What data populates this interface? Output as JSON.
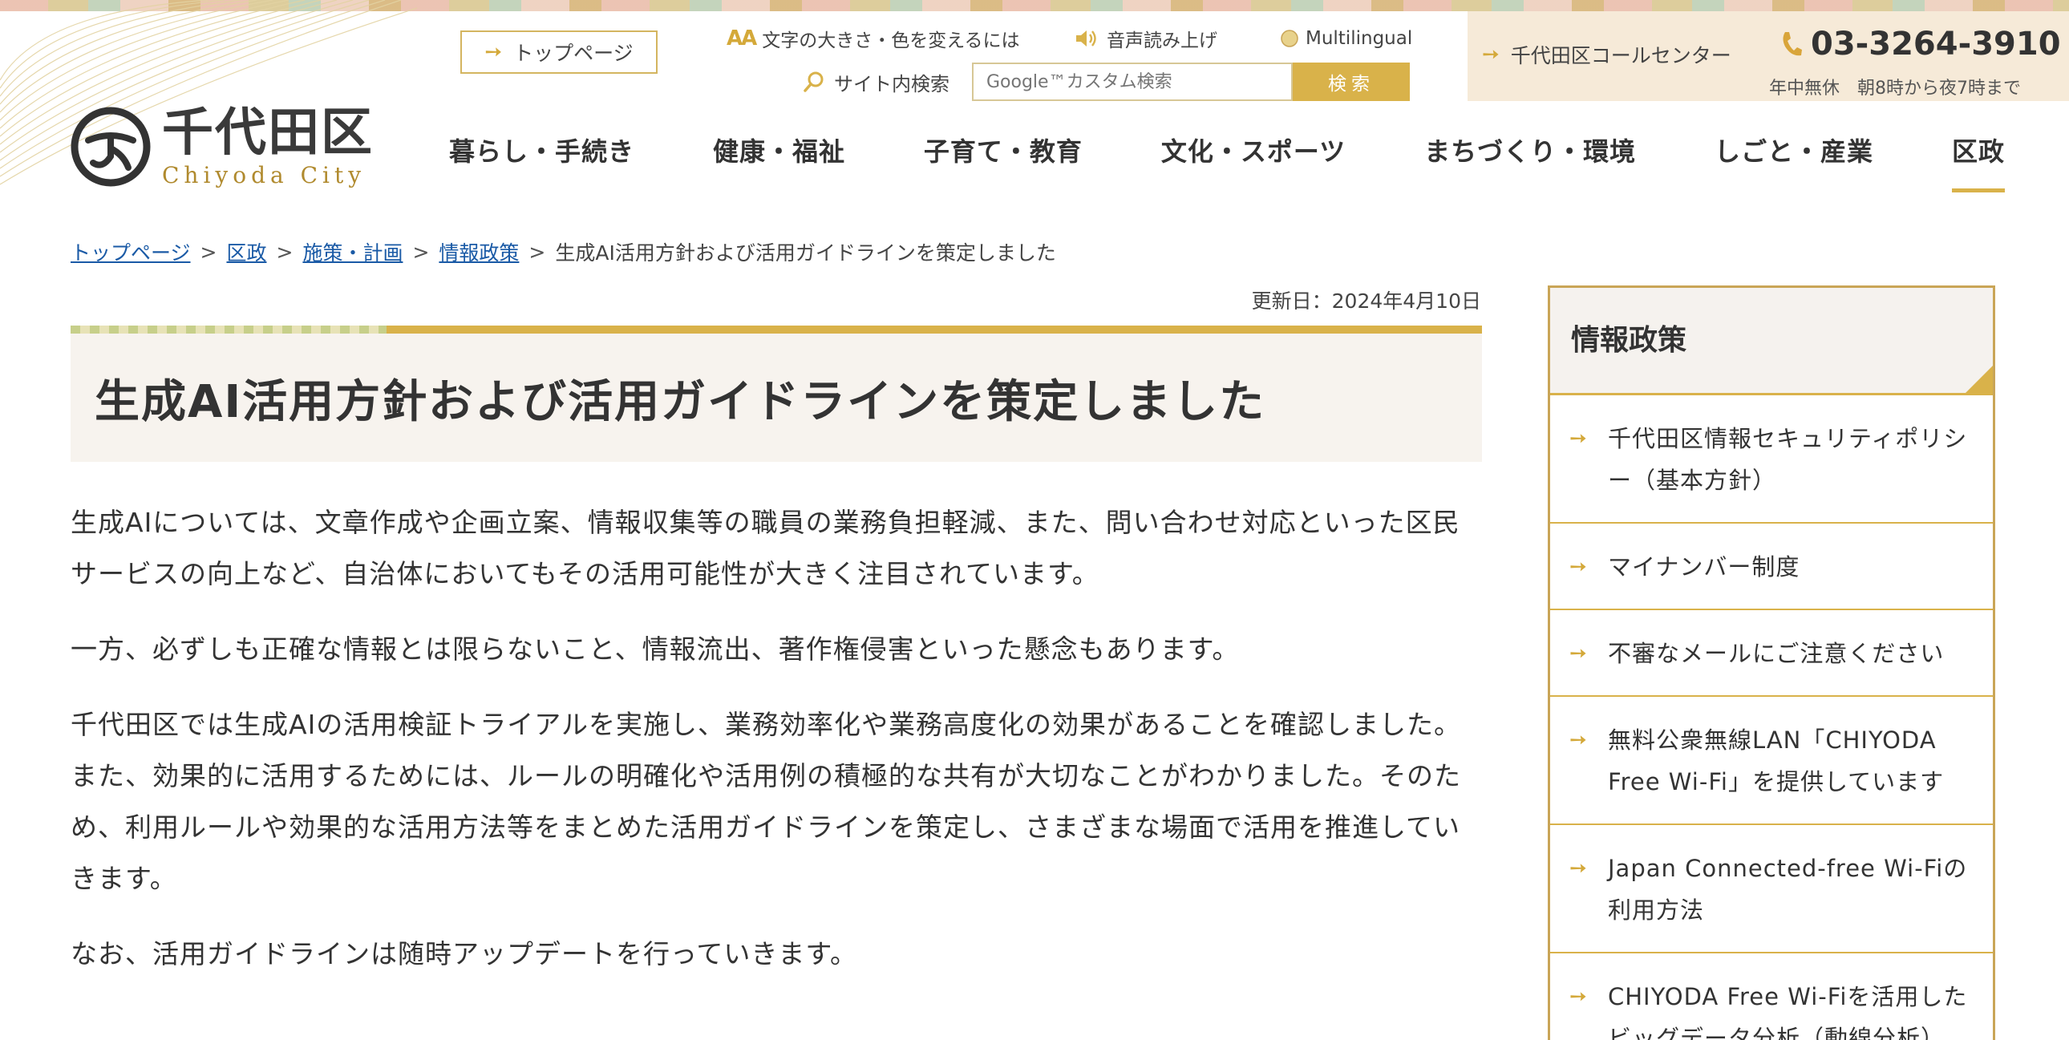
{
  "header": {
    "logo_jp": "千代田区",
    "logo_en": "Chiyoda City",
    "top_page_label": "トップページ",
    "font_color_label": "文字の大きさ・色を変えるには",
    "voice_label": "音声読み上げ",
    "multilingual_label": "Multilingual",
    "site_search_label": "サイト内検索",
    "search_placeholder": "Google™カスタム検索",
    "search_button": "検索",
    "call_center": {
      "name": "千代田区コールセンター",
      "phone": "03-3264-3910",
      "hours": "年中無休　朝8時から夜7時まで"
    }
  },
  "nav": {
    "items": [
      "暮らし・手続き",
      "健康・福祉",
      "子育て・教育",
      "文化・スポーツ",
      "まちづくり・環境",
      "しごと・産業",
      "区政"
    ]
  },
  "breadcrumb": {
    "items": [
      "トップページ",
      "区政",
      "施策・計画",
      "情報政策"
    ],
    "current": "生成AI活用方針および活用ガイドラインを策定しました"
  },
  "updated": "更新日：2024年4月10日",
  "page_title": "生成AI活用方針および活用ガイドラインを策定しました",
  "paragraphs": [
    "生成AIについては、文章作成や企画立案、情報収集等の職員の業務負担軽減、また、問い合わせ対応といった区民サービスの向上など、自治体においてもその活用可能性が大きく注目されています。",
    "一方、必ずしも正確な情報とは限らないこと、情報流出、著作権侵害といった懸念もあります。",
    "千代田区では生成AIの活用検証トライアルを実施し、業務効率化や業務高度化の効果があることを確認しました。また、効果的に活用するためには、ルールの明確化や活用例の積極的な共有が大切なことがわかりました。そのため、利用ルールや効果的な活用方法等をまとめた活用ガイドラインを策定し、さまざまな場面で活用を推進していきます。",
    "なお、活用ガイドラインは随時アップデートを行っていきます。"
  ],
  "sidebar": {
    "title": "情報政策",
    "items": [
      "千代田区情報セキュリティポリシー（基本方針）",
      "マイナンバー制度",
      "不審なメールにご注意ください",
      "無料公衆無線LAN「CHIYODA Free Wi-Fi」を提供しています",
      "Japan Connected-free Wi-Fiの利用方法",
      "CHIYODA Free Wi-Fiを活用したビッグデータ分析（動線分析）"
    ]
  },
  "colors": {
    "accent_gold": "#d9b24a",
    "link_blue": "#1a5aa6",
    "call_bg": "#f6ead8",
    "title_bg": "#f7f3ee"
  }
}
